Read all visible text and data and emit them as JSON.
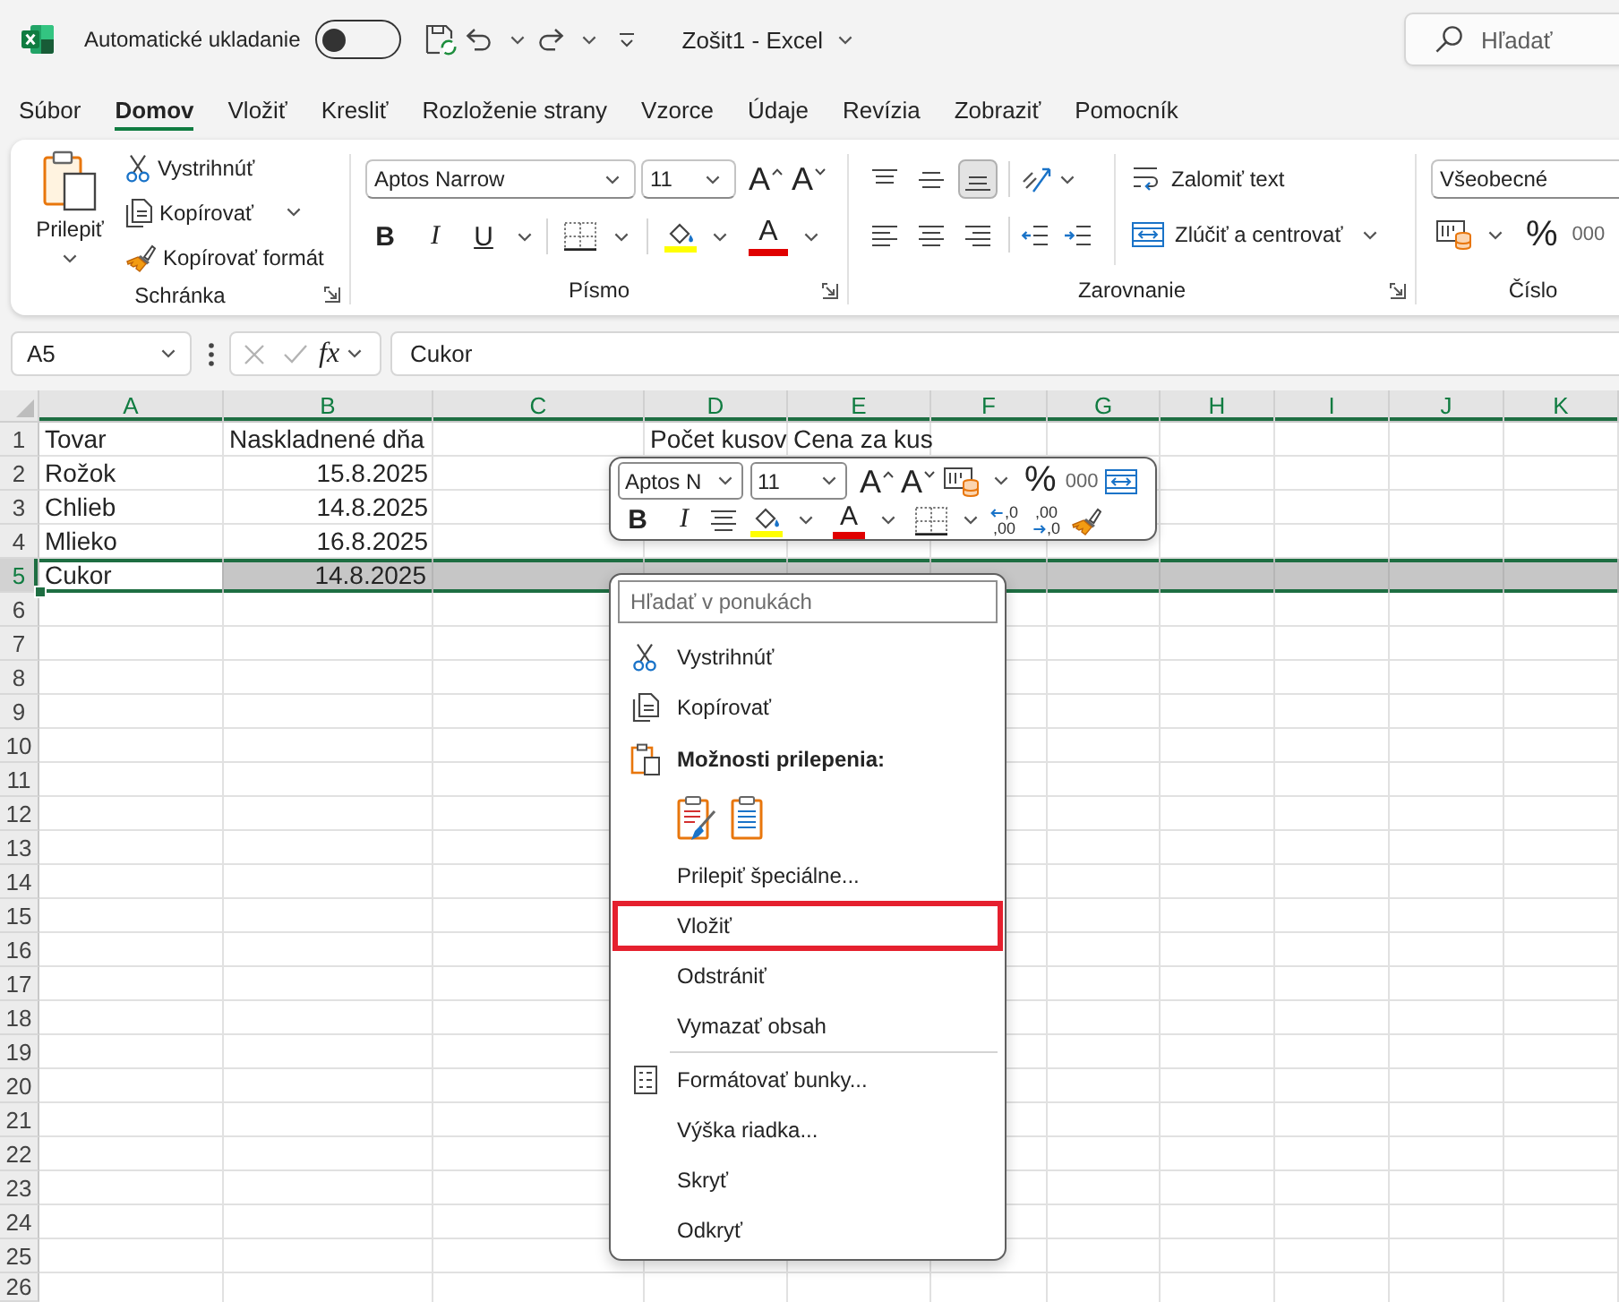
{
  "title_bar": {
    "autosave_label": "Automatické ukladanie",
    "autosave_on": false,
    "title": "Zošit1 - Excel",
    "search": {
      "placeholder": "Hľadať"
    }
  },
  "tabs": [
    {
      "label": "Súbor",
      "selected": false
    },
    {
      "label": "Domov",
      "selected": true
    },
    {
      "label": "Vložiť",
      "selected": false
    },
    {
      "label": "Kresliť",
      "selected": false
    },
    {
      "label": "Rozloženie strany",
      "selected": false
    },
    {
      "label": "Vzorce",
      "selected": false
    },
    {
      "label": "Údaje",
      "selected": false
    },
    {
      "label": "Revízia",
      "selected": false
    },
    {
      "label": "Zobraziť",
      "selected": false
    },
    {
      "label": "Pomocník",
      "selected": false
    }
  ],
  "ribbon": {
    "clipboard": {
      "paste": "Prilepiť",
      "cut": "Vystrihnúť",
      "copy": "Kopírovať",
      "format_painter": "Kopírovať formát",
      "label": "Schránka"
    },
    "font": {
      "font_name": "Aptos Narrow",
      "font_size": "11",
      "grow": "A",
      "shrink": "A",
      "bold": "B",
      "italic": "I",
      "underline": "U",
      "font_color": "A",
      "label": "Písmo"
    },
    "alignment": {
      "vertical": [
        {
          "kind": "top",
          "selected": false
        },
        {
          "kind": "middle",
          "selected": false
        },
        {
          "kind": "bottom",
          "selected": true
        }
      ],
      "horizontal": [
        {
          "kind": "left",
          "selected": false
        },
        {
          "kind": "center",
          "selected": false
        },
        {
          "kind": "right",
          "selected": false
        }
      ],
      "wrap_text": "Zalomiť text",
      "merge": "Zlúčiť a centrovať",
      "label": "Zarovnanie"
    },
    "number": {
      "format": "Všeobecné",
      "percent": "%",
      "thousands": "000",
      "label": "Číslo"
    }
  },
  "formula_bar": {
    "name_box": "A5",
    "function_label": "fx",
    "formula": "Cukor"
  },
  "sheet": {
    "columns": [
      {
        "label": "A",
        "highlighted": true
      },
      {
        "label": "B",
        "highlighted": true
      },
      {
        "label": "C",
        "highlighted": true
      },
      {
        "label": "D",
        "highlighted": true
      },
      {
        "label": "E",
        "highlighted": true
      },
      {
        "label": "F",
        "highlighted": true
      },
      {
        "label": "G",
        "highlighted": true
      },
      {
        "label": "H",
        "highlighted": true
      },
      {
        "label": "I",
        "highlighted": true
      },
      {
        "label": "J",
        "highlighted": true
      },
      {
        "label": "K",
        "highlighted": true
      }
    ],
    "rows": [
      {
        "number": "1",
        "selected": false,
        "cells": [
          {
            "text": "Tovar",
            "kind": "text",
            "active": false
          },
          {
            "text": "Naskladnené dňa",
            "kind": "text",
            "active": false
          },
          null,
          {
            "text": "Počet kusov",
            "kind": "text",
            "active": false
          },
          {
            "text": "Cena za kus",
            "kind": "text",
            "active": false
          }
        ]
      },
      {
        "number": "2",
        "selected": false,
        "cells": [
          {
            "text": "Rožok",
            "kind": "text",
            "active": false
          },
          {
            "text": "15.8.2025",
            "kind": "number",
            "active": false
          }
        ]
      },
      {
        "number": "3",
        "selected": false,
        "cells": [
          {
            "text": "Chlieb",
            "kind": "text",
            "active": false
          },
          {
            "text": "14.8.2025",
            "kind": "number",
            "active": false
          }
        ]
      },
      {
        "number": "4",
        "selected": false,
        "cells": [
          {
            "text": "Mlieko",
            "kind": "text",
            "active": false
          },
          {
            "text": "16.8.2025",
            "kind": "number",
            "active": false
          }
        ]
      },
      {
        "number": "5",
        "selected": true,
        "cells": [
          {
            "text": "Cukor",
            "kind": "text",
            "active": true
          },
          {
            "text": "14.8.2025",
            "kind": "number",
            "active": false
          }
        ]
      },
      {
        "number": "6",
        "selected": false
      },
      {
        "number": "7",
        "selected": false
      },
      {
        "number": "8",
        "selected": false
      },
      {
        "number": "9",
        "selected": false
      },
      {
        "number": "10",
        "selected": false
      },
      {
        "number": "11",
        "selected": false
      },
      {
        "number": "12",
        "selected": false
      },
      {
        "number": "13",
        "selected": false
      },
      {
        "number": "14",
        "selected": false
      },
      {
        "number": "15",
        "selected": false
      },
      {
        "number": "16",
        "selected": false
      },
      {
        "number": "17",
        "selected": false
      },
      {
        "number": "18",
        "selected": false
      },
      {
        "number": "19",
        "selected": false
      },
      {
        "number": "20",
        "selected": false
      },
      {
        "number": "21",
        "selected": false
      },
      {
        "number": "22",
        "selected": false
      },
      {
        "number": "23",
        "selected": false
      },
      {
        "number": "24",
        "selected": false
      },
      {
        "number": "25",
        "selected": false
      },
      {
        "number": "26",
        "selected": false
      }
    ]
  },
  "mini_toolbar": {
    "font_name": "Aptos N",
    "font_size": "11",
    "grow": "A",
    "shrink": "A",
    "percent": "%",
    "thousands": "000",
    "bold": "B",
    "italic": "I",
    "font_color": "A",
    "decrease_decimal": [
      ",0",
      ",00"
    ],
    "increase_decimal": [
      ",00",
      ",0"
    ]
  },
  "context_menu": {
    "search": {
      "placeholder": "Hľadať v ponukách"
    },
    "items": [
      {
        "kind": "cut",
        "label": "Vystrihnúť",
        "divider_above": false,
        "marked": false
      },
      {
        "kind": "copy",
        "label": "Kopírovať",
        "divider_above": false,
        "marked": false
      },
      {
        "kind": "heading",
        "label": "Možnosti prilepenia:",
        "divider_above": false,
        "marked": false
      },
      {
        "kind": "paste_options",
        "divider_above": false,
        "marked": false
      },
      {
        "kind": "plain",
        "label": "Prilepiť špeciálne...",
        "divider_above": false,
        "marked": false
      },
      {
        "kind": "plain",
        "label": "Vložiť",
        "divider_above": false,
        "marked": true
      },
      {
        "kind": "plain",
        "label": "Odstrániť",
        "divider_above": false,
        "marked": false
      },
      {
        "kind": "plain",
        "label": "Vymazať obsah",
        "divider_above": false,
        "marked": false
      },
      {
        "kind": "format",
        "label": "Formátovať bunky...",
        "divider_above": true,
        "marked": false
      },
      {
        "kind": "plain",
        "label": "Výška riadka...",
        "divider_above": false,
        "marked": false
      },
      {
        "kind": "plain",
        "label": "Skryť",
        "divider_above": false,
        "marked": false
      },
      {
        "kind": "plain",
        "label": "Odkryť",
        "divider_above": false,
        "marked": false
      }
    ]
  }
}
